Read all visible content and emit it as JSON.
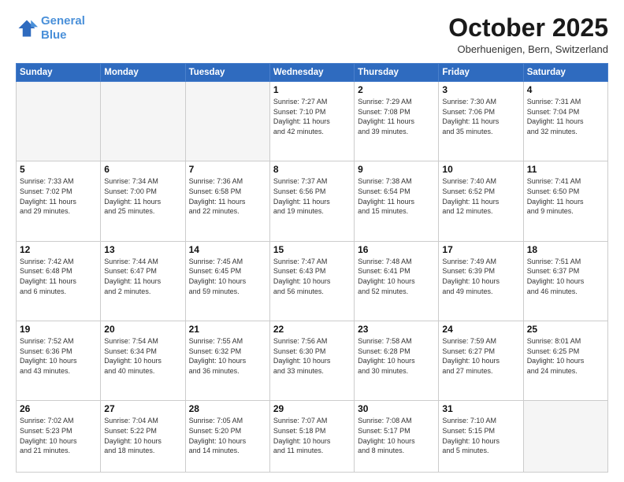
{
  "header": {
    "logo_line1": "General",
    "logo_line2": "Blue",
    "month": "October 2025",
    "location": "Oberhuenigen, Bern, Switzerland"
  },
  "weekdays": [
    "Sunday",
    "Monday",
    "Tuesday",
    "Wednesday",
    "Thursday",
    "Friday",
    "Saturday"
  ],
  "weeks": [
    [
      {
        "day": "",
        "info": ""
      },
      {
        "day": "",
        "info": ""
      },
      {
        "day": "",
        "info": ""
      },
      {
        "day": "1",
        "info": "Sunrise: 7:27 AM\nSunset: 7:10 PM\nDaylight: 11 hours\nand 42 minutes."
      },
      {
        "day": "2",
        "info": "Sunrise: 7:29 AM\nSunset: 7:08 PM\nDaylight: 11 hours\nand 39 minutes."
      },
      {
        "day": "3",
        "info": "Sunrise: 7:30 AM\nSunset: 7:06 PM\nDaylight: 11 hours\nand 35 minutes."
      },
      {
        "day": "4",
        "info": "Sunrise: 7:31 AM\nSunset: 7:04 PM\nDaylight: 11 hours\nand 32 minutes."
      }
    ],
    [
      {
        "day": "5",
        "info": "Sunrise: 7:33 AM\nSunset: 7:02 PM\nDaylight: 11 hours\nand 29 minutes."
      },
      {
        "day": "6",
        "info": "Sunrise: 7:34 AM\nSunset: 7:00 PM\nDaylight: 11 hours\nand 25 minutes."
      },
      {
        "day": "7",
        "info": "Sunrise: 7:36 AM\nSunset: 6:58 PM\nDaylight: 11 hours\nand 22 minutes."
      },
      {
        "day": "8",
        "info": "Sunrise: 7:37 AM\nSunset: 6:56 PM\nDaylight: 11 hours\nand 19 minutes."
      },
      {
        "day": "9",
        "info": "Sunrise: 7:38 AM\nSunset: 6:54 PM\nDaylight: 11 hours\nand 15 minutes."
      },
      {
        "day": "10",
        "info": "Sunrise: 7:40 AM\nSunset: 6:52 PM\nDaylight: 11 hours\nand 12 minutes."
      },
      {
        "day": "11",
        "info": "Sunrise: 7:41 AM\nSunset: 6:50 PM\nDaylight: 11 hours\nand 9 minutes."
      }
    ],
    [
      {
        "day": "12",
        "info": "Sunrise: 7:42 AM\nSunset: 6:48 PM\nDaylight: 11 hours\nand 6 minutes."
      },
      {
        "day": "13",
        "info": "Sunrise: 7:44 AM\nSunset: 6:47 PM\nDaylight: 11 hours\nand 2 minutes."
      },
      {
        "day": "14",
        "info": "Sunrise: 7:45 AM\nSunset: 6:45 PM\nDaylight: 10 hours\nand 59 minutes."
      },
      {
        "day": "15",
        "info": "Sunrise: 7:47 AM\nSunset: 6:43 PM\nDaylight: 10 hours\nand 56 minutes."
      },
      {
        "day": "16",
        "info": "Sunrise: 7:48 AM\nSunset: 6:41 PM\nDaylight: 10 hours\nand 52 minutes."
      },
      {
        "day": "17",
        "info": "Sunrise: 7:49 AM\nSunset: 6:39 PM\nDaylight: 10 hours\nand 49 minutes."
      },
      {
        "day": "18",
        "info": "Sunrise: 7:51 AM\nSunset: 6:37 PM\nDaylight: 10 hours\nand 46 minutes."
      }
    ],
    [
      {
        "day": "19",
        "info": "Sunrise: 7:52 AM\nSunset: 6:36 PM\nDaylight: 10 hours\nand 43 minutes."
      },
      {
        "day": "20",
        "info": "Sunrise: 7:54 AM\nSunset: 6:34 PM\nDaylight: 10 hours\nand 40 minutes."
      },
      {
        "day": "21",
        "info": "Sunrise: 7:55 AM\nSunset: 6:32 PM\nDaylight: 10 hours\nand 36 minutes."
      },
      {
        "day": "22",
        "info": "Sunrise: 7:56 AM\nSunset: 6:30 PM\nDaylight: 10 hours\nand 33 minutes."
      },
      {
        "day": "23",
        "info": "Sunrise: 7:58 AM\nSunset: 6:28 PM\nDaylight: 10 hours\nand 30 minutes."
      },
      {
        "day": "24",
        "info": "Sunrise: 7:59 AM\nSunset: 6:27 PM\nDaylight: 10 hours\nand 27 minutes."
      },
      {
        "day": "25",
        "info": "Sunrise: 8:01 AM\nSunset: 6:25 PM\nDaylight: 10 hours\nand 24 minutes."
      }
    ],
    [
      {
        "day": "26",
        "info": "Sunrise: 7:02 AM\nSunset: 5:23 PM\nDaylight: 10 hours\nand 21 minutes."
      },
      {
        "day": "27",
        "info": "Sunrise: 7:04 AM\nSunset: 5:22 PM\nDaylight: 10 hours\nand 18 minutes."
      },
      {
        "day": "28",
        "info": "Sunrise: 7:05 AM\nSunset: 5:20 PM\nDaylight: 10 hours\nand 14 minutes."
      },
      {
        "day": "29",
        "info": "Sunrise: 7:07 AM\nSunset: 5:18 PM\nDaylight: 10 hours\nand 11 minutes."
      },
      {
        "day": "30",
        "info": "Sunrise: 7:08 AM\nSunset: 5:17 PM\nDaylight: 10 hours\nand 8 minutes."
      },
      {
        "day": "31",
        "info": "Sunrise: 7:10 AM\nSunset: 5:15 PM\nDaylight: 10 hours\nand 5 minutes."
      },
      {
        "day": "",
        "info": ""
      }
    ]
  ]
}
